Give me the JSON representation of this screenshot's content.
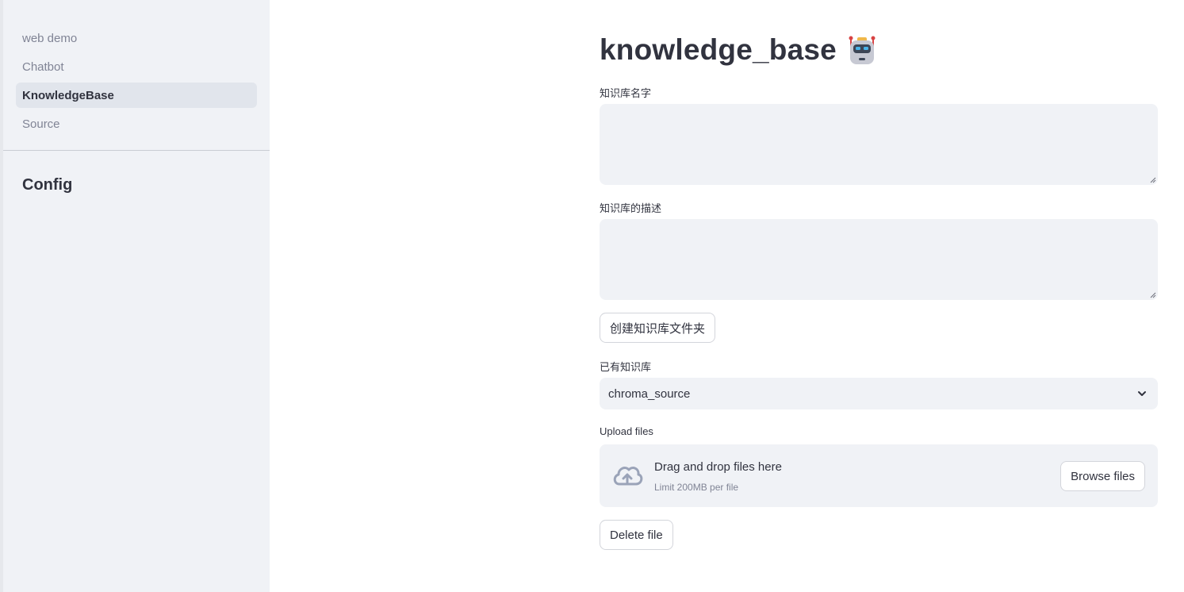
{
  "sidebar": {
    "nav": [
      {
        "label": "web demo",
        "active": false
      },
      {
        "label": "Chatbot",
        "active": false
      },
      {
        "label": "KnowledgeBase",
        "active": true
      },
      {
        "label": "Source",
        "active": false
      }
    ],
    "config_title": "Config"
  },
  "main": {
    "title": "knowledge_base",
    "title_icon": "robot-icon",
    "kb_name_label": "知识库名字",
    "kb_name_value": "",
    "kb_desc_label": "知识库的描述",
    "kb_desc_value": "",
    "create_button": "创建知识库文件夹",
    "existing_label": "已有知识库",
    "existing_selected": "chroma_source",
    "upload_label": "Upload files",
    "drop_text": "Drag and drop files here",
    "drop_limit": "Limit 200MB per file",
    "browse_button": "Browse files",
    "delete_button": "Delete file"
  },
  "colors": {
    "sidebar_bg": "#f0f2f6",
    "active_nav_bg": "#e1e5ec",
    "input_bg": "#f0f2f6",
    "text": "#31333f",
    "muted": "#808495"
  }
}
